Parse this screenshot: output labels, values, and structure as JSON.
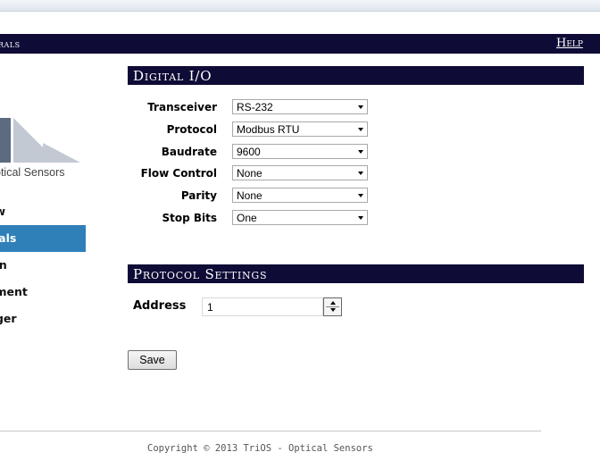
{
  "header": {
    "title": "rals",
    "help_label": "Help"
  },
  "logo": {
    "text": "ptical Sensors"
  },
  "nav": {
    "items": [
      {
        "label": "ew"
      },
      {
        "label": "rals",
        "active": true
      },
      {
        "label": "ion"
      },
      {
        "label": "ement"
      },
      {
        "label": "gger"
      }
    ]
  },
  "digital_io": {
    "header": "Digital I/O",
    "fields": [
      {
        "label": "Transceiver",
        "value": "RS-232"
      },
      {
        "label": "Protocol",
        "value": "Modbus RTU"
      },
      {
        "label": "Baudrate",
        "value": "9600"
      },
      {
        "label": "Flow Control",
        "value": "None"
      },
      {
        "label": "Parity",
        "value": "None"
      },
      {
        "label": "Stop Bits",
        "value": "One"
      }
    ]
  },
  "protocol_settings": {
    "header": "Protocol Settings",
    "address_label": "Address",
    "address_value": "1"
  },
  "save_label": "Save",
  "footer": {
    "copyright": "Copyright © 2013 TriOS - Optical Sensors"
  },
  "colors": {
    "header_bg": "#0e0b36",
    "active_nav": "#2f7fb9"
  }
}
